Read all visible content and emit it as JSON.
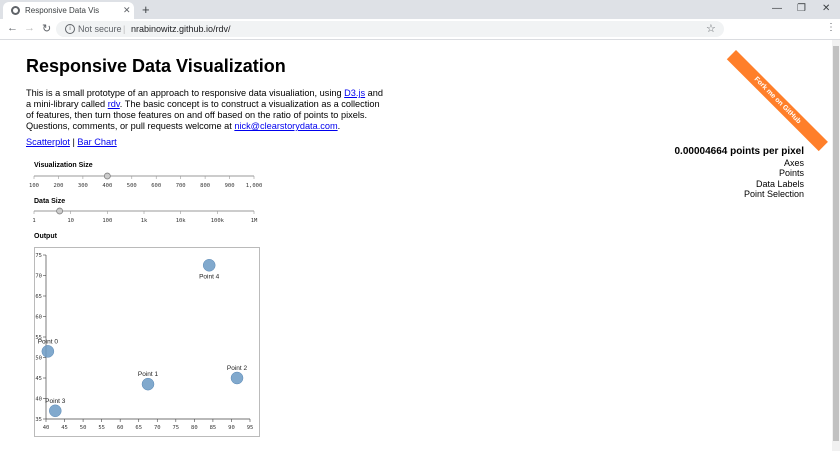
{
  "browser": {
    "tab_title": "Responsive Data Vis",
    "url": "nrabinowitz.github.io/rdv/",
    "security": "Not secure"
  },
  "page": {
    "title": "Responsive Data Visualization",
    "intro": {
      "t1": "This is a small prototype of an approach to responsive data visualiation, using ",
      "l1": "D3.js",
      "t2": " and a mini-library called ",
      "l2": "rdv",
      "t3": ". The basic concept is to construct a visualization as a collection of features, then turn those features on and off based on the ratio of points to pixels. Questions, comments, or pull requests welcome at ",
      "l3": "nick@clearstorydata.com",
      "t4": "."
    },
    "links": {
      "scatterplot": "Scatterplot",
      "sep": " | ",
      "bar_chart": "Bar Chart"
    },
    "ribbon": "Fork me on GitHub",
    "ppp": "0.00004664 points per pixel",
    "features": [
      "Axes",
      "Points",
      "Data Labels",
      "Point Selection"
    ],
    "viz_size": {
      "label": "Visualization Size",
      "ticks": [
        "100",
        "200",
        "300",
        "400",
        "500",
        "600",
        "700",
        "800",
        "900",
        "1,000"
      ],
      "value": 400
    },
    "data_size": {
      "label": "Data Size",
      "ticks": [
        "1",
        "10",
        "100",
        "1k",
        "10k",
        "100k",
        "1M"
      ],
      "value": 5
    },
    "output_label": "Output"
  },
  "chart_data": {
    "type": "scatter",
    "xlim": [
      40,
      95
    ],
    "ylim": [
      35,
      75
    ],
    "xticks": [
      40,
      45,
      50,
      55,
      60,
      65,
      70,
      75,
      80,
      85,
      90,
      95
    ],
    "yticks": [
      35,
      40,
      45,
      50,
      55,
      60,
      65,
      70,
      75
    ],
    "color": "#6b9ac4",
    "points": [
      {
        "label": "Point 0",
        "x": 40.5,
        "y": 51.5
      },
      {
        "label": "Point 1",
        "x": 67.5,
        "y": 43.5
      },
      {
        "label": "Point 2",
        "x": 91.5,
        "y": 45.0
      },
      {
        "label": "Point 3",
        "x": 42.5,
        "y": 37.0
      },
      {
        "label": "Point 4",
        "x": 84.0,
        "y": 72.5
      }
    ]
  }
}
